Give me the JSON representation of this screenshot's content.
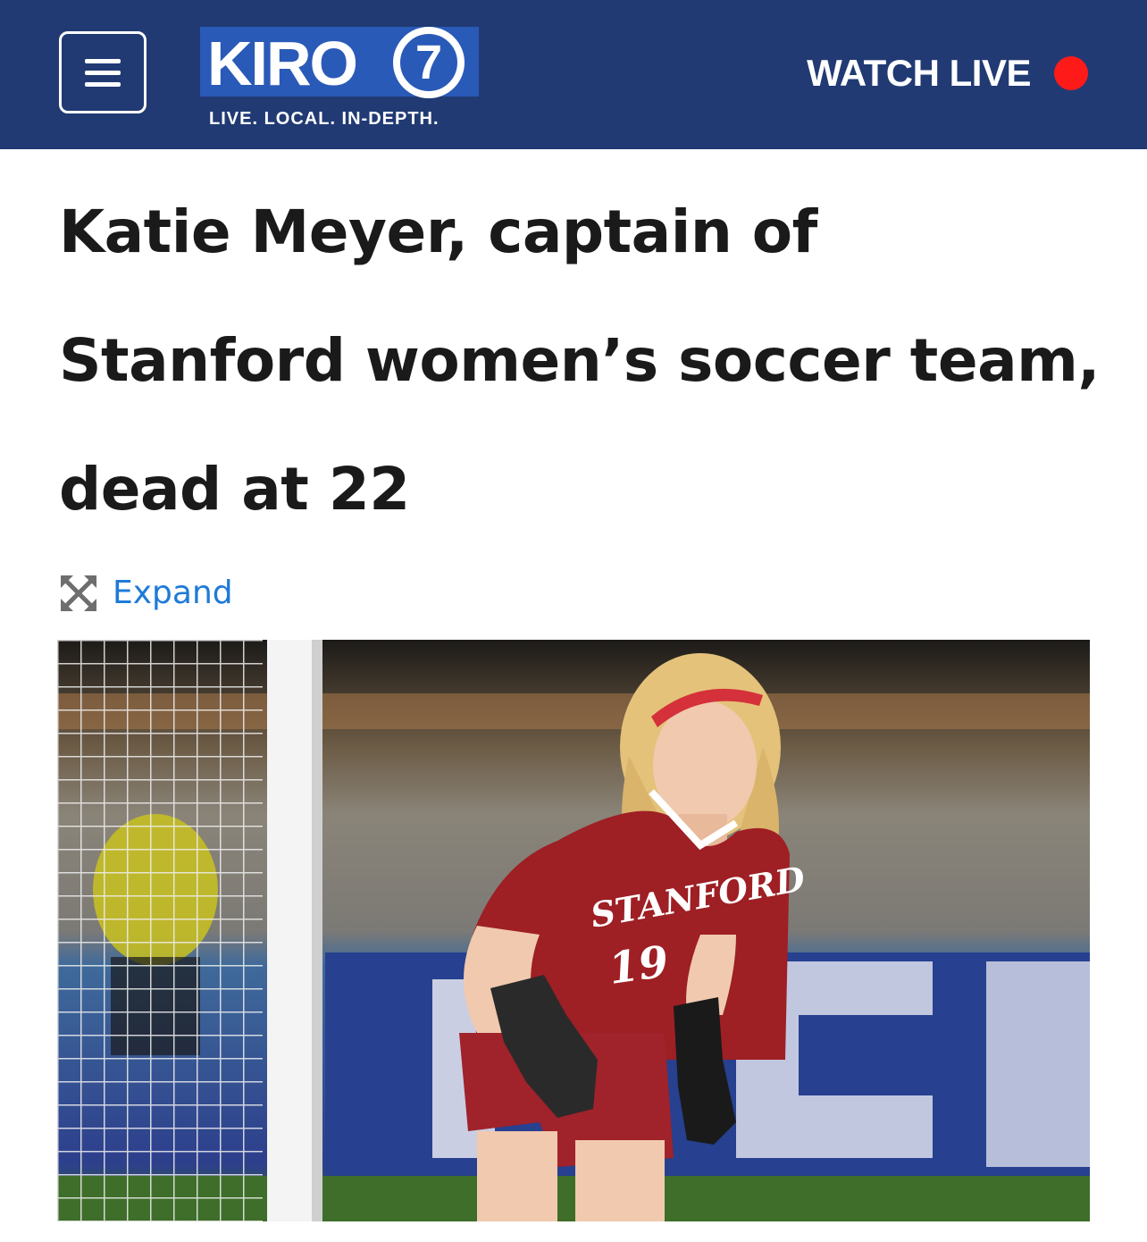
{
  "header": {
    "logo_text": "KIRO",
    "logo_number": "7",
    "tagline": "LIVE. LOCAL. IN-DEPTH.",
    "watch_live_label": "WATCH LIVE",
    "colors": {
      "bar": "#213a73",
      "logo": "#2a5ab8",
      "live_dot": "#ff1a1a"
    }
  },
  "article": {
    "headline": "Katie Meyer, captain of Stanford women’s soccer team, dead at 22",
    "expand_label": "Expand",
    "photo": {
      "jersey_text": "STANFORD",
      "jersey_number": "19"
    }
  },
  "icons": [
    "menu-icon",
    "expand-icon"
  ]
}
